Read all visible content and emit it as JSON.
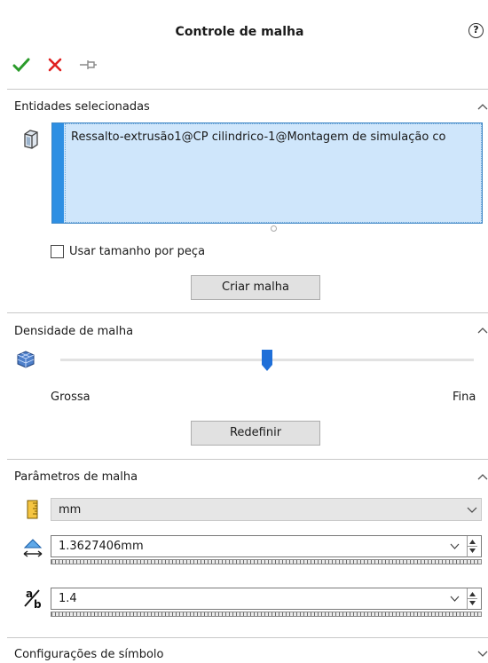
{
  "header": {
    "title": "Controle de malha",
    "help_glyph": "?",
    "icons": {
      "ok": "check-icon",
      "cancel": "close-icon",
      "pin": "pushpin-icon"
    },
    "colors": {
      "ok": "#2a9b2a",
      "cancel": "#e02020"
    }
  },
  "selected_entities": {
    "title": "Entidades selecionadas",
    "items": [
      "Ressalto-extrusão1@CP cilindrico-1@Montagem de simulação co"
    ],
    "use_part_size_label": "Usar tamanho por peça",
    "use_part_size_checked": false,
    "create_mesh_button": "Criar malha",
    "list_colors": {
      "background": "#cfe6fb",
      "bar": "#2e8fe3",
      "border": "#3d86c6"
    }
  },
  "mesh_density": {
    "title": "Densidade de malha",
    "left_label": "Grossa",
    "right_label": "Fina",
    "slider_value": 0.5,
    "reset_button": "Redefinir",
    "thumb_color": "#1f6fd8"
  },
  "mesh_parameters": {
    "title": "Parâmetros de malha",
    "unit": "mm",
    "element_size": "1.3627406mm",
    "ratio": "1.4"
  },
  "symbol_settings": {
    "title": "Configurações de símbolo"
  }
}
